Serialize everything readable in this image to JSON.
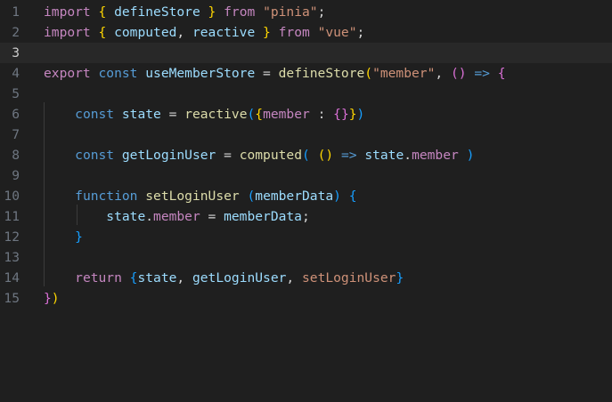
{
  "editor": {
    "current_line": 3,
    "colors": {
      "background": "#1f1f1f",
      "current_line": "#282828",
      "keyword_purple": "#c586c0",
      "keyword_blue": "#569cd6",
      "variable": "#9cdcfe",
      "property": "#c586c0",
      "function": "#dcdcaa",
      "string": "#ce9178",
      "punctuation": "#d4d4d4",
      "bracket_gold": "#ffd700",
      "bracket_pink": "#da70d6",
      "bracket_blue": "#179fff",
      "line_number": "#6e7681"
    },
    "lines": [
      {
        "num": "1",
        "tokens": [
          {
            "t": "import",
            "c": "#c586c0"
          },
          {
            "t": " ",
            "c": "#d4d4d4"
          },
          {
            "t": "{",
            "c": "#ffd700"
          },
          {
            "t": " defineStore ",
            "c": "#9cdcfe"
          },
          {
            "t": "}",
            "c": "#ffd700"
          },
          {
            "t": " from ",
            "c": "#c586c0"
          },
          {
            "t": "\"pinia\"",
            "c": "#ce9178"
          },
          {
            "t": ";",
            "c": "#d4d4d4"
          }
        ]
      },
      {
        "num": "2",
        "tokens": [
          {
            "t": "import",
            "c": "#c586c0"
          },
          {
            "t": " ",
            "c": "#d4d4d4"
          },
          {
            "t": "{",
            "c": "#ffd700"
          },
          {
            "t": " computed",
            "c": "#9cdcfe"
          },
          {
            "t": ", ",
            "c": "#d4d4d4"
          },
          {
            "t": "reactive ",
            "c": "#9cdcfe"
          },
          {
            "t": "}",
            "c": "#ffd700"
          },
          {
            "t": " from ",
            "c": "#c586c0"
          },
          {
            "t": "\"vue\"",
            "c": "#ce9178"
          },
          {
            "t": ";",
            "c": "#d4d4d4"
          }
        ]
      },
      {
        "num": "3",
        "tokens": []
      },
      {
        "num": "4",
        "tokens": [
          {
            "t": "export",
            "c": "#c586c0"
          },
          {
            "t": " ",
            "c": "#d4d4d4"
          },
          {
            "t": "const",
            "c": "#569cd6"
          },
          {
            "t": " ",
            "c": "#d4d4d4"
          },
          {
            "t": "useMemberStore",
            "c": "#9cdcfe"
          },
          {
            "t": " = ",
            "c": "#d4d4d4"
          },
          {
            "t": "defineStore",
            "c": "#dcdcaa"
          },
          {
            "t": "(",
            "c": "#ffd700"
          },
          {
            "t": "\"member\"",
            "c": "#ce9178"
          },
          {
            "t": ", ",
            "c": "#d4d4d4"
          },
          {
            "t": "()",
            "c": "#da70d6"
          },
          {
            "t": " ",
            "c": "#d4d4d4"
          },
          {
            "t": "=>",
            "c": "#569cd6"
          },
          {
            "t": " ",
            "c": "#d4d4d4"
          },
          {
            "t": "{",
            "c": "#da70d6"
          }
        ]
      },
      {
        "num": "5",
        "tokens": []
      },
      {
        "num": "6",
        "tokens": [
          {
            "t": "    ",
            "c": "#d4d4d4"
          },
          {
            "t": "const",
            "c": "#569cd6"
          },
          {
            "t": " ",
            "c": "#d4d4d4"
          },
          {
            "t": "state",
            "c": "#9cdcfe"
          },
          {
            "t": " = ",
            "c": "#d4d4d4"
          },
          {
            "t": "reactive",
            "c": "#dcdcaa"
          },
          {
            "t": "(",
            "c": "#179fff"
          },
          {
            "t": "{",
            "c": "#ffd700"
          },
          {
            "t": "member",
            "c": "#c586c0"
          },
          {
            "t": " : ",
            "c": "#d4d4d4"
          },
          {
            "t": "{}",
            "c": "#da70d6"
          },
          {
            "t": "}",
            "c": "#ffd700"
          },
          {
            "t": ")",
            "c": "#179fff"
          }
        ]
      },
      {
        "num": "7",
        "tokens": []
      },
      {
        "num": "8",
        "tokens": [
          {
            "t": "    ",
            "c": "#d4d4d4"
          },
          {
            "t": "const",
            "c": "#569cd6"
          },
          {
            "t": " ",
            "c": "#d4d4d4"
          },
          {
            "t": "getLoginUser",
            "c": "#9cdcfe"
          },
          {
            "t": " = ",
            "c": "#d4d4d4"
          },
          {
            "t": "computed",
            "c": "#dcdcaa"
          },
          {
            "t": "(",
            "c": "#179fff"
          },
          {
            "t": " ",
            "c": "#d4d4d4"
          },
          {
            "t": "()",
            "c": "#ffd700"
          },
          {
            "t": " ",
            "c": "#d4d4d4"
          },
          {
            "t": "=>",
            "c": "#569cd6"
          },
          {
            "t": " ",
            "c": "#d4d4d4"
          },
          {
            "t": "state",
            "c": "#9cdcfe"
          },
          {
            "t": ".",
            "c": "#d4d4d4"
          },
          {
            "t": "member",
            "c": "#c586c0"
          },
          {
            "t": " ",
            "c": "#d4d4d4"
          },
          {
            "t": ")",
            "c": "#179fff"
          }
        ]
      },
      {
        "num": "9",
        "tokens": []
      },
      {
        "num": "10",
        "tokens": [
          {
            "t": "    ",
            "c": "#d4d4d4"
          },
          {
            "t": "function",
            "c": "#569cd6"
          },
          {
            "t": " ",
            "c": "#d4d4d4"
          },
          {
            "t": "setLoginUser",
            "c": "#dcdcaa"
          },
          {
            "t": " ",
            "c": "#d4d4d4"
          },
          {
            "t": "(",
            "c": "#179fff"
          },
          {
            "t": "memberData",
            "c": "#9cdcfe"
          },
          {
            "t": ")",
            "c": "#179fff"
          },
          {
            "t": " ",
            "c": "#d4d4d4"
          },
          {
            "t": "{",
            "c": "#179fff"
          }
        ]
      },
      {
        "num": "11",
        "tokens": [
          {
            "t": "        ",
            "c": "#d4d4d4"
          },
          {
            "t": "state",
            "c": "#9cdcfe"
          },
          {
            "t": ".",
            "c": "#d4d4d4"
          },
          {
            "t": "member",
            "c": "#c586c0"
          },
          {
            "t": " = ",
            "c": "#d4d4d4"
          },
          {
            "t": "memberData",
            "c": "#9cdcfe"
          },
          {
            "t": ";",
            "c": "#d4d4d4"
          }
        ]
      },
      {
        "num": "12",
        "tokens": [
          {
            "t": "    ",
            "c": "#d4d4d4"
          },
          {
            "t": "}",
            "c": "#179fff"
          }
        ]
      },
      {
        "num": "13",
        "tokens": []
      },
      {
        "num": "14",
        "tokens": [
          {
            "t": "    ",
            "c": "#d4d4d4"
          },
          {
            "t": "return",
            "c": "#c586c0"
          },
          {
            "t": " ",
            "c": "#d4d4d4"
          },
          {
            "t": "{",
            "c": "#179fff"
          },
          {
            "t": "state",
            "c": "#9cdcfe"
          },
          {
            "t": ", ",
            "c": "#d4d4d4"
          },
          {
            "t": "getLoginUser",
            "c": "#9cdcfe"
          },
          {
            "t": ", ",
            "c": "#d4d4d4"
          },
          {
            "t": "setLoginUser",
            "c": "#ce9178"
          },
          {
            "t": "}",
            "c": "#179fff"
          }
        ]
      },
      {
        "num": "15",
        "tokens": [
          {
            "t": "}",
            "c": "#da70d6"
          },
          {
            "t": ")",
            "c": "#ffd700"
          }
        ]
      }
    ]
  }
}
